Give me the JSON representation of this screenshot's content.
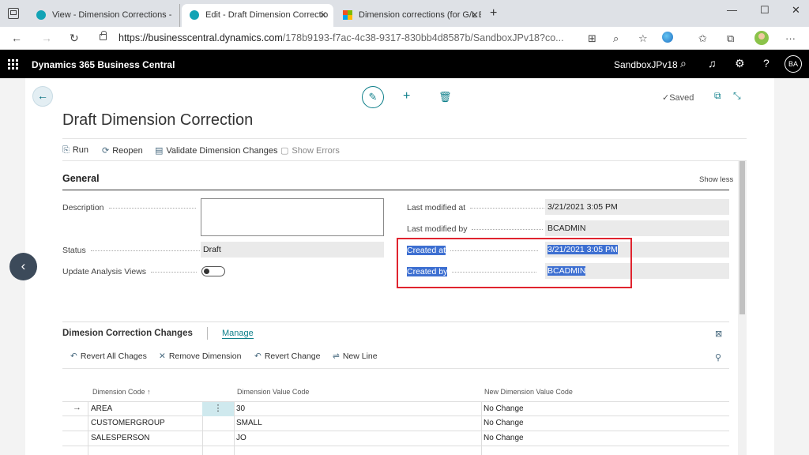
{
  "browser": {
    "tabs": [
      {
        "title": "View - Dimension Corrections - D"
      },
      {
        "title": "Edit - Draft Dimension Correctio"
      },
      {
        "title": "Dimension corrections (for G/L E"
      }
    ],
    "url_main": "https://businesscentral.dynamics.com",
    "url_rest": "/178b9193-f7ac-4c38-9317-830bb4d8587b/SandboxJPv18?co..."
  },
  "app": {
    "title": "Dynamics 365 Business Central",
    "company": "SandboxJPv18",
    "user_initials": "BA"
  },
  "page": {
    "saved": "Saved",
    "title": "Draft Dimension Correction",
    "actions": [
      "Run",
      "Reopen",
      "Validate Dimension Changes",
      "Show Errors"
    ]
  },
  "general": {
    "title": "General",
    "show_less": "Show less",
    "description_label": "Description",
    "description_value": "",
    "status_label": "Status",
    "status_value": "Draft",
    "update_analysis_label": "Update Analysis Views",
    "last_modified_at_label": "Last modified at",
    "last_modified_at_value": "3/21/2021 3:05 PM",
    "last_modified_by_label": "Last modified by",
    "last_modified_by_value": "BCADMIN",
    "created_at_label": "Created at",
    "created_at_value": "3/21/2021 3:05 PM",
    "created_by_label": "Created by",
    "created_by_value": "BCADMIN"
  },
  "part": {
    "title": "Dimesion Correction Changes",
    "manage": "Manage",
    "actions": [
      "Revert All Chages",
      "Remove Dimension",
      "Revert Change",
      "New Line"
    ],
    "columns": [
      "Dimension Code",
      "Dimension Value Code",
      "New Dimension Value Code"
    ],
    "sort_indicator": "↑",
    "rows": [
      {
        "code": "AREA",
        "value": "30",
        "new_value": "No Change"
      },
      {
        "code": "CUSTOMERGROUP",
        "value": "SMALL",
        "new_value": "No Change"
      },
      {
        "code": "SALESPERSON",
        "value": "JO",
        "new_value": "No Change"
      }
    ]
  }
}
